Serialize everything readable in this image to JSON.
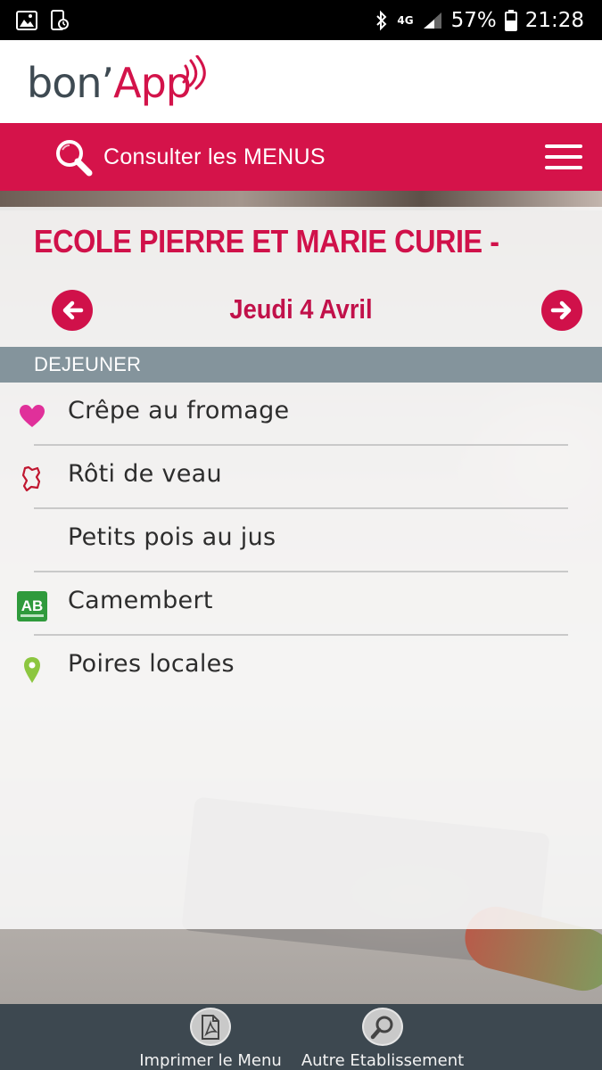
{
  "status_bar": {
    "network": "4G",
    "battery": "57%",
    "time": "21:28"
  },
  "header": {
    "logo_part1": "bon’",
    "logo_part2": "App"
  },
  "menubar": {
    "search_label": "Consulter les MENUS"
  },
  "main": {
    "school_name": "ECOLE PIERRE ET MARIE CURIE -",
    "date": "Jeudi 4 Avril",
    "section_title": "DEJEUNER",
    "items": [
      {
        "label": "Crêpe au fromage",
        "icon": "heart-icon"
      },
      {
        "label": "Rôti de veau",
        "icon": "origin-map-icon"
      },
      {
        "label": "Petits pois au jus",
        "icon": ""
      },
      {
        "label": "Camembert",
        "icon": "organic-ab-icon"
      },
      {
        "label": "Poires locales",
        "icon": "location-pin-icon"
      }
    ]
  },
  "bottom_bar": {
    "print_label": "Imprimer le Menu",
    "other_label": "Autre Etablissement"
  },
  "colors": {
    "brand_red": "#d5134a",
    "section_grey": "#84949c",
    "bottom_bar": "#3d4850",
    "logo_text": "#3e4a52"
  }
}
